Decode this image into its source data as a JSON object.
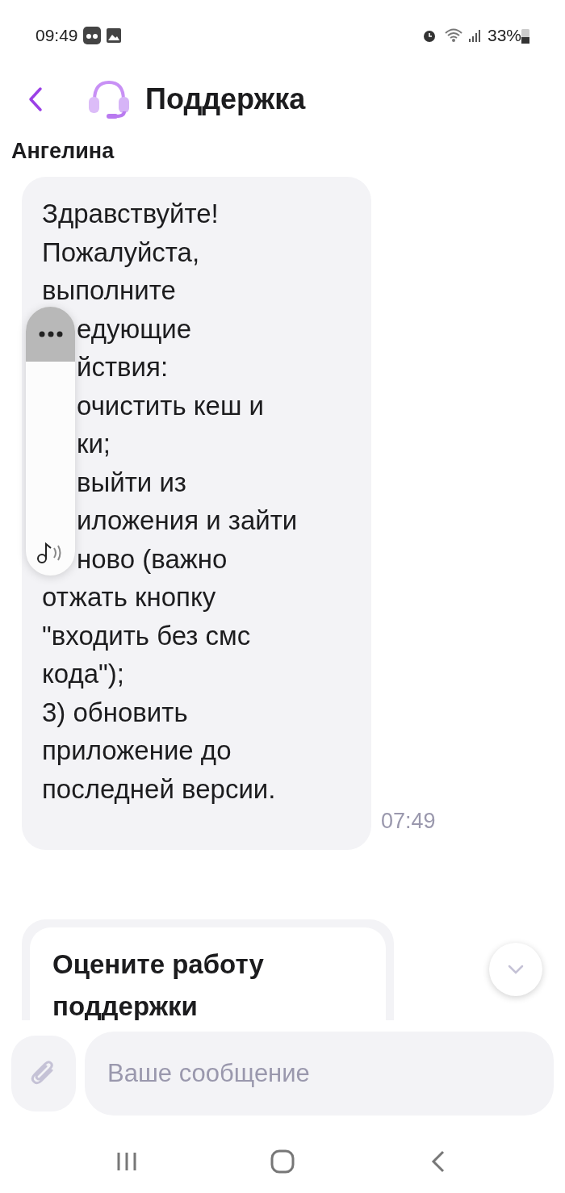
{
  "status_bar": {
    "time": "09:49",
    "battery": "33%"
  },
  "header": {
    "title": "Поддержка"
  },
  "sender": "Ангелина",
  "message": {
    "lines_before": [
      "Здравствуйте!",
      "Пожалуйста,",
      "выполните"
    ],
    "lines_behind_panel": [
      "едующие",
      "йствия:",
      "очистить кеш и",
      "ки;",
      "выйти из",
      "иложения и зайти",
      "ново (важно"
    ],
    "lines_after": [
      "отжать кнопку",
      "\"входить без смс",
      "кода\");",
      "3) обновить",
      "приложение до",
      "последней версии."
    ],
    "time": "07:49"
  },
  "rating_card": {
    "title": "Оцените работу поддержки"
  },
  "composer": {
    "placeholder": "Ваше сообщение"
  }
}
